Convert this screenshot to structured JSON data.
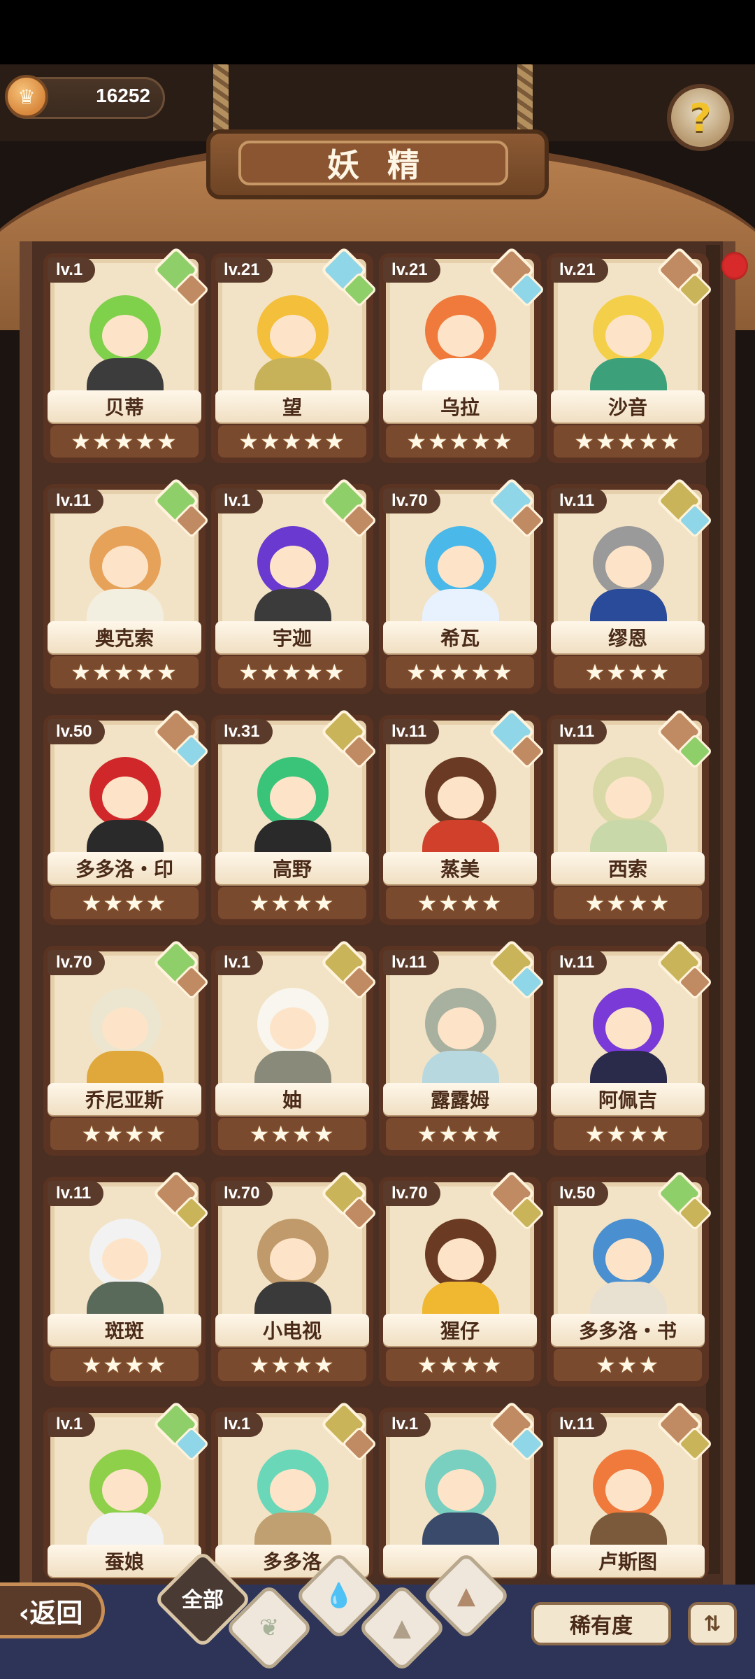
{
  "header": {
    "currency": "16252",
    "title": "妖精",
    "help_icon": "?"
  },
  "colors": {
    "rarity_green": "#8fcf6a",
    "rarity_blue": "#8fd6e8",
    "rarity_brown": "#c08a62",
    "rarity_gold": "#c9b45a"
  },
  "cards": [
    {
      "level": "lv.1",
      "name": "贝蒂",
      "stars": "★★★★★",
      "hair": "#7fd04a",
      "outfit": "#3c3c3c",
      "gem1": "#8fcf6a",
      "gem2": "#c08a62"
    },
    {
      "level": "lv.21",
      "name": "望",
      "stars": "★★★★★",
      "hair": "#f4bf3a",
      "outfit": "#c7b25a",
      "gem1": "#8fd6e8",
      "gem2": "#8fcf6a"
    },
    {
      "level": "lv.21",
      "name": "乌拉",
      "stars": "★★★★★",
      "hair": "#f07a3c",
      "outfit": "#ffffff",
      "gem1": "#c08a62",
      "gem2": "#8fd6e8"
    },
    {
      "level": "lv.21",
      "name": "沙音",
      "stars": "★★★★★",
      "hair": "#f4d04a",
      "outfit": "#3ca07a",
      "gem1": "#c08a62",
      "gem2": "#c9b45a"
    },
    {
      "level": "lv.11",
      "name": "奥克索",
      "stars": "★★★★★",
      "hair": "#e7a25a",
      "outfit": "#f3efe0",
      "gem1": "#8fcf6a",
      "gem2": "#c08a62"
    },
    {
      "level": "lv.1",
      "name": "宇迦",
      "stars": "★★★★★",
      "hair": "#6a3ad0",
      "outfit": "#3b3b3b",
      "gem1": "#8fcf6a",
      "gem2": "#c08a62"
    },
    {
      "level": "lv.70",
      "name": "希瓦",
      "stars": "★★★★★",
      "hair": "#4ab8e8",
      "outfit": "#e8f2ff",
      "gem1": "#8fd6e8",
      "gem2": "#c08a62"
    },
    {
      "level": "lv.11",
      "name": "缪恩",
      "stars": "★★★★",
      "hair": "#9a9a9a",
      "outfit": "#2a4a9a",
      "gem1": "#c9b45a",
      "gem2": "#8fd6e8"
    },
    {
      "level": "lv.50",
      "name": "多多洛・印",
      "stars": "★★★★",
      "hair": "#d0282a",
      "outfit": "#2a2a2a",
      "gem1": "#c08a62",
      "gem2": "#8fd6e8"
    },
    {
      "level": "lv.31",
      "name": "高野",
      "stars": "★★★★",
      "hair": "#3ac47a",
      "outfit": "#2a2a2a",
      "gem1": "#c9b45a",
      "gem2": "#c08a62"
    },
    {
      "level": "lv.11",
      "name": "蒸美",
      "stars": "★★★★",
      "hair": "#6a3a24",
      "outfit": "#d0402a",
      "gem1": "#8fd6e8",
      "gem2": "#c08a62"
    },
    {
      "level": "lv.11",
      "name": "西索",
      "stars": "★★★★",
      "hair": "#d8d9a6",
      "outfit": "#c8d8a8",
      "gem1": "#c08a62",
      "gem2": "#8fcf6a"
    },
    {
      "level": "lv.70",
      "name": "乔尼亚斯",
      "stars": "★★★★",
      "hair": "#ece6d0",
      "outfit": "#e0a83a",
      "gem1": "#8fcf6a",
      "gem2": "#c08a62"
    },
    {
      "level": "lv.1",
      "name": "妯",
      "stars": "★★★★",
      "hair": "#f8f6ee",
      "outfit": "#8a8a7a",
      "gem1": "#c9b45a",
      "gem2": "#c08a62"
    },
    {
      "level": "lv.11",
      "name": "露露姆",
      "stars": "★★★★",
      "hair": "#a8b0a0",
      "outfit": "#b8d8e0",
      "gem1": "#c9b45a",
      "gem2": "#8fd6e8"
    },
    {
      "level": "lv.11",
      "name": "阿佩吉",
      "stars": "★★★★",
      "hair": "#7a3ad8",
      "outfit": "#2a2a4a",
      "gem1": "#c9b45a",
      "gem2": "#c08a62"
    },
    {
      "level": "lv.11",
      "name": "斑斑",
      "stars": "★★★★",
      "hair": "#f2f2f2",
      "outfit": "#5a6a5a",
      "gem1": "#c08a62",
      "gem2": "#c9b45a"
    },
    {
      "level": "lv.70",
      "name": "小电视",
      "stars": "★★★★",
      "hair": "#c09a6a",
      "outfit": "#3a3a3a",
      "gem1": "#c9b45a",
      "gem2": "#c08a62"
    },
    {
      "level": "lv.70",
      "name": "猩仔",
      "stars": "★★★★",
      "hair": "#6a3a22",
      "outfit": "#f0b830",
      "gem1": "#c08a62",
      "gem2": "#c9b45a"
    },
    {
      "level": "lv.50",
      "name": "多多洛・书",
      "stars": "★★★",
      "hair": "#4a90d0",
      "outfit": "#e8e0d0",
      "gem1": "#8fcf6a",
      "gem2": "#c9b45a"
    },
    {
      "level": "lv.1",
      "name": "蚕娘",
      "stars": "",
      "hair": "#8fd04a",
      "outfit": "#f2f2f2",
      "gem1": "#8fcf6a",
      "gem2": "#8fd6e8"
    },
    {
      "level": "lv.1",
      "name": "多多洛",
      "stars": "",
      "hair": "#6ad8b8",
      "outfit": "#c0a070",
      "gem1": "#c9b45a",
      "gem2": "#c08a62"
    },
    {
      "level": "lv.1",
      "name": "",
      "stars": "",
      "hair": "#7ad0c0",
      "outfit": "#3a4a6a",
      "gem1": "#c08a62",
      "gem2": "#8fd6e8"
    },
    {
      "level": "lv.11",
      "name": "卢斯图",
      "stars": "",
      "hair": "#f07a3c",
      "outfit": "#7a5a3a",
      "gem1": "#c08a62",
      "gem2": "#c9b45a"
    }
  ],
  "bottom": {
    "back_label": "‹返回",
    "tab_all_label": "全部",
    "rarity_label": "稀有度",
    "sort_icon": "⇅"
  }
}
